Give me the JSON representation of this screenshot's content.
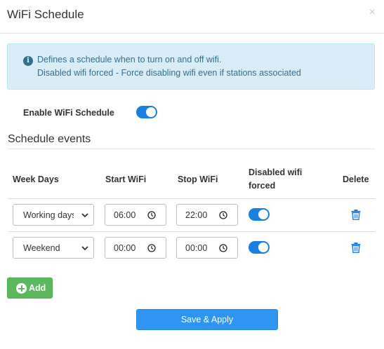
{
  "modal": {
    "title": "WiFi Schedule",
    "close_symbol": "×"
  },
  "info": {
    "line1": "Defines a schedule when to turn on and off wifi.",
    "line2": "Disabled wifi forced - Force disabling wifi even if stations associated"
  },
  "enable": {
    "label": "Enable WiFi Schedule",
    "on": true
  },
  "section": {
    "title": "Schedule events"
  },
  "table": {
    "headers": {
      "week_days": "Week Days",
      "start_wifi": "Start WiFi",
      "stop_wifi": "Stop WiFi",
      "disabled_line1": "Disabled wifi",
      "disabled_line2": "forced",
      "delete": "Delete"
    },
    "rows": [
      {
        "week_days": "Working days",
        "start": "06:00",
        "stop": "22:00",
        "disabled_forced": true
      },
      {
        "week_days": "Weekend",
        "start": "00:00",
        "stop": "00:00",
        "disabled_forced": true
      }
    ]
  },
  "buttons": {
    "add": "Add",
    "save": "Save & Apply"
  },
  "colors": {
    "accent": "#1a7fe3",
    "add_green": "#5cb85c",
    "save_blue": "#2f95f3",
    "info_bg": "#d9edf7",
    "info_text": "#31708f"
  }
}
